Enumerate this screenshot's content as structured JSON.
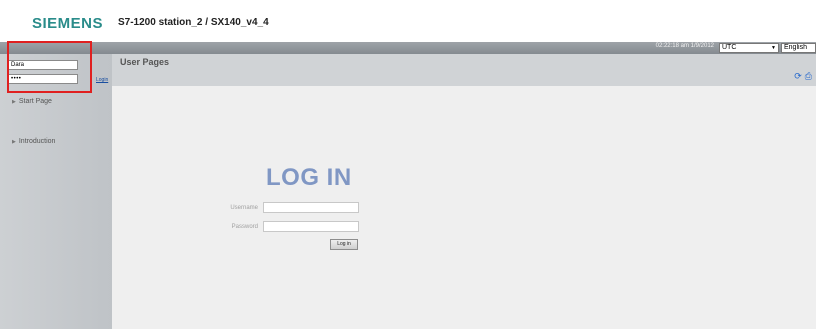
{
  "header": {
    "logo": "SIEMENS",
    "station_title": "S7-1200 station_2 / SX140_v4_4",
    "datetime": "02:22:18 am  1/9/2012",
    "timezone": "UTC",
    "language": "English"
  },
  "sidebar": {
    "login": {
      "username_value": "Dara",
      "password_value": "••••",
      "login_link": "Login"
    },
    "items": [
      {
        "label": "Start Page"
      },
      {
        "label": "Introduction"
      }
    ]
  },
  "page": {
    "title": "User Pages",
    "icons": [
      "refresh-icon",
      "print-icon"
    ]
  },
  "login_form": {
    "heading": "LOG IN",
    "username_label": "Username",
    "password_label": "Password",
    "button_label": "Log in"
  },
  "colors": {
    "brand": "#2a8c8a",
    "heading": "#8097c4",
    "highlight": "#e02020",
    "link": "#1a4fa0"
  }
}
